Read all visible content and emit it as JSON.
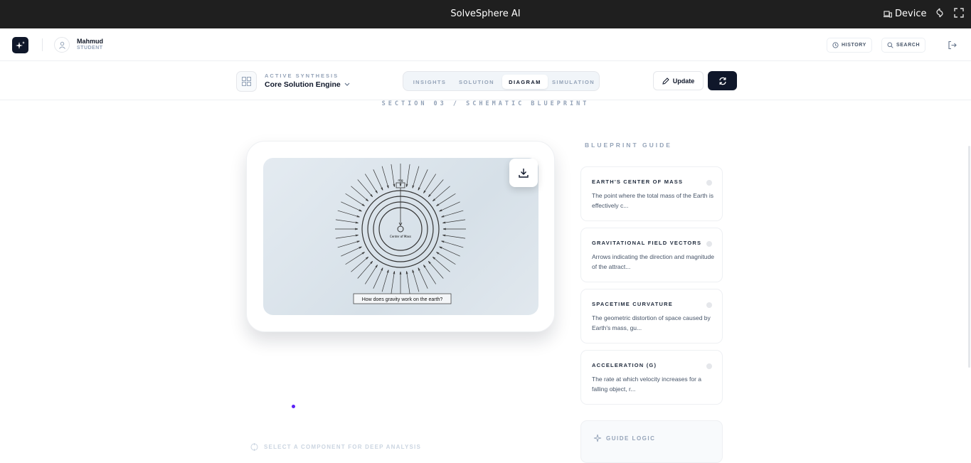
{
  "topbar": {
    "title": "SolveSphere AI",
    "device_label": "Device"
  },
  "user": {
    "name": "Mahmud",
    "role": "STUDENT"
  },
  "header": {
    "history_label": "HISTORY",
    "search_label": "SEARCH"
  },
  "toolbar": {
    "active_label": "ACTIVE SYNTHESIS",
    "engine_title": "Core Solution Engine",
    "tabs": [
      {
        "label": "INSIGHTS",
        "active": false
      },
      {
        "label": "SOLUTION",
        "active": false
      },
      {
        "label": "DIAGRAM",
        "active": true
      },
      {
        "label": "SIMULATION",
        "active": false
      }
    ],
    "update_label": "Update"
  },
  "section_title": "SECTION 03 / SCHEMATIC BLUEPRINT",
  "diagram": {
    "top_label": "mg",
    "center_label": "Center of Mass",
    "caption": "How does gravity work on the earth?"
  },
  "guide": {
    "title": "BLUEPRINT GUIDE",
    "items": [
      {
        "title": "EARTH'S CENTER OF MASS",
        "desc": "The point where the total mass of the Earth is effectively c..."
      },
      {
        "title": "GRAVITATIONAL FIELD VECTORS",
        "desc": "Arrows indicating the direction and magnitude of the attract..."
      },
      {
        "title": "SPACETIME CURVATURE",
        "desc": "The geometric distortion of space caused by Earth's mass, gu..."
      },
      {
        "title": "ACCELERATION (G)",
        "desc": "The rate at which velocity increases for a falling object, r..."
      }
    ],
    "logic_label": "GUIDE LOGIC"
  },
  "hint": "SELECT A COMPONENT FOR DEEP ANALYSIS",
  "colors": {
    "dark": "#0f172a",
    "accent_dot": "#5b21f6",
    "muted": "#94a3b8"
  }
}
